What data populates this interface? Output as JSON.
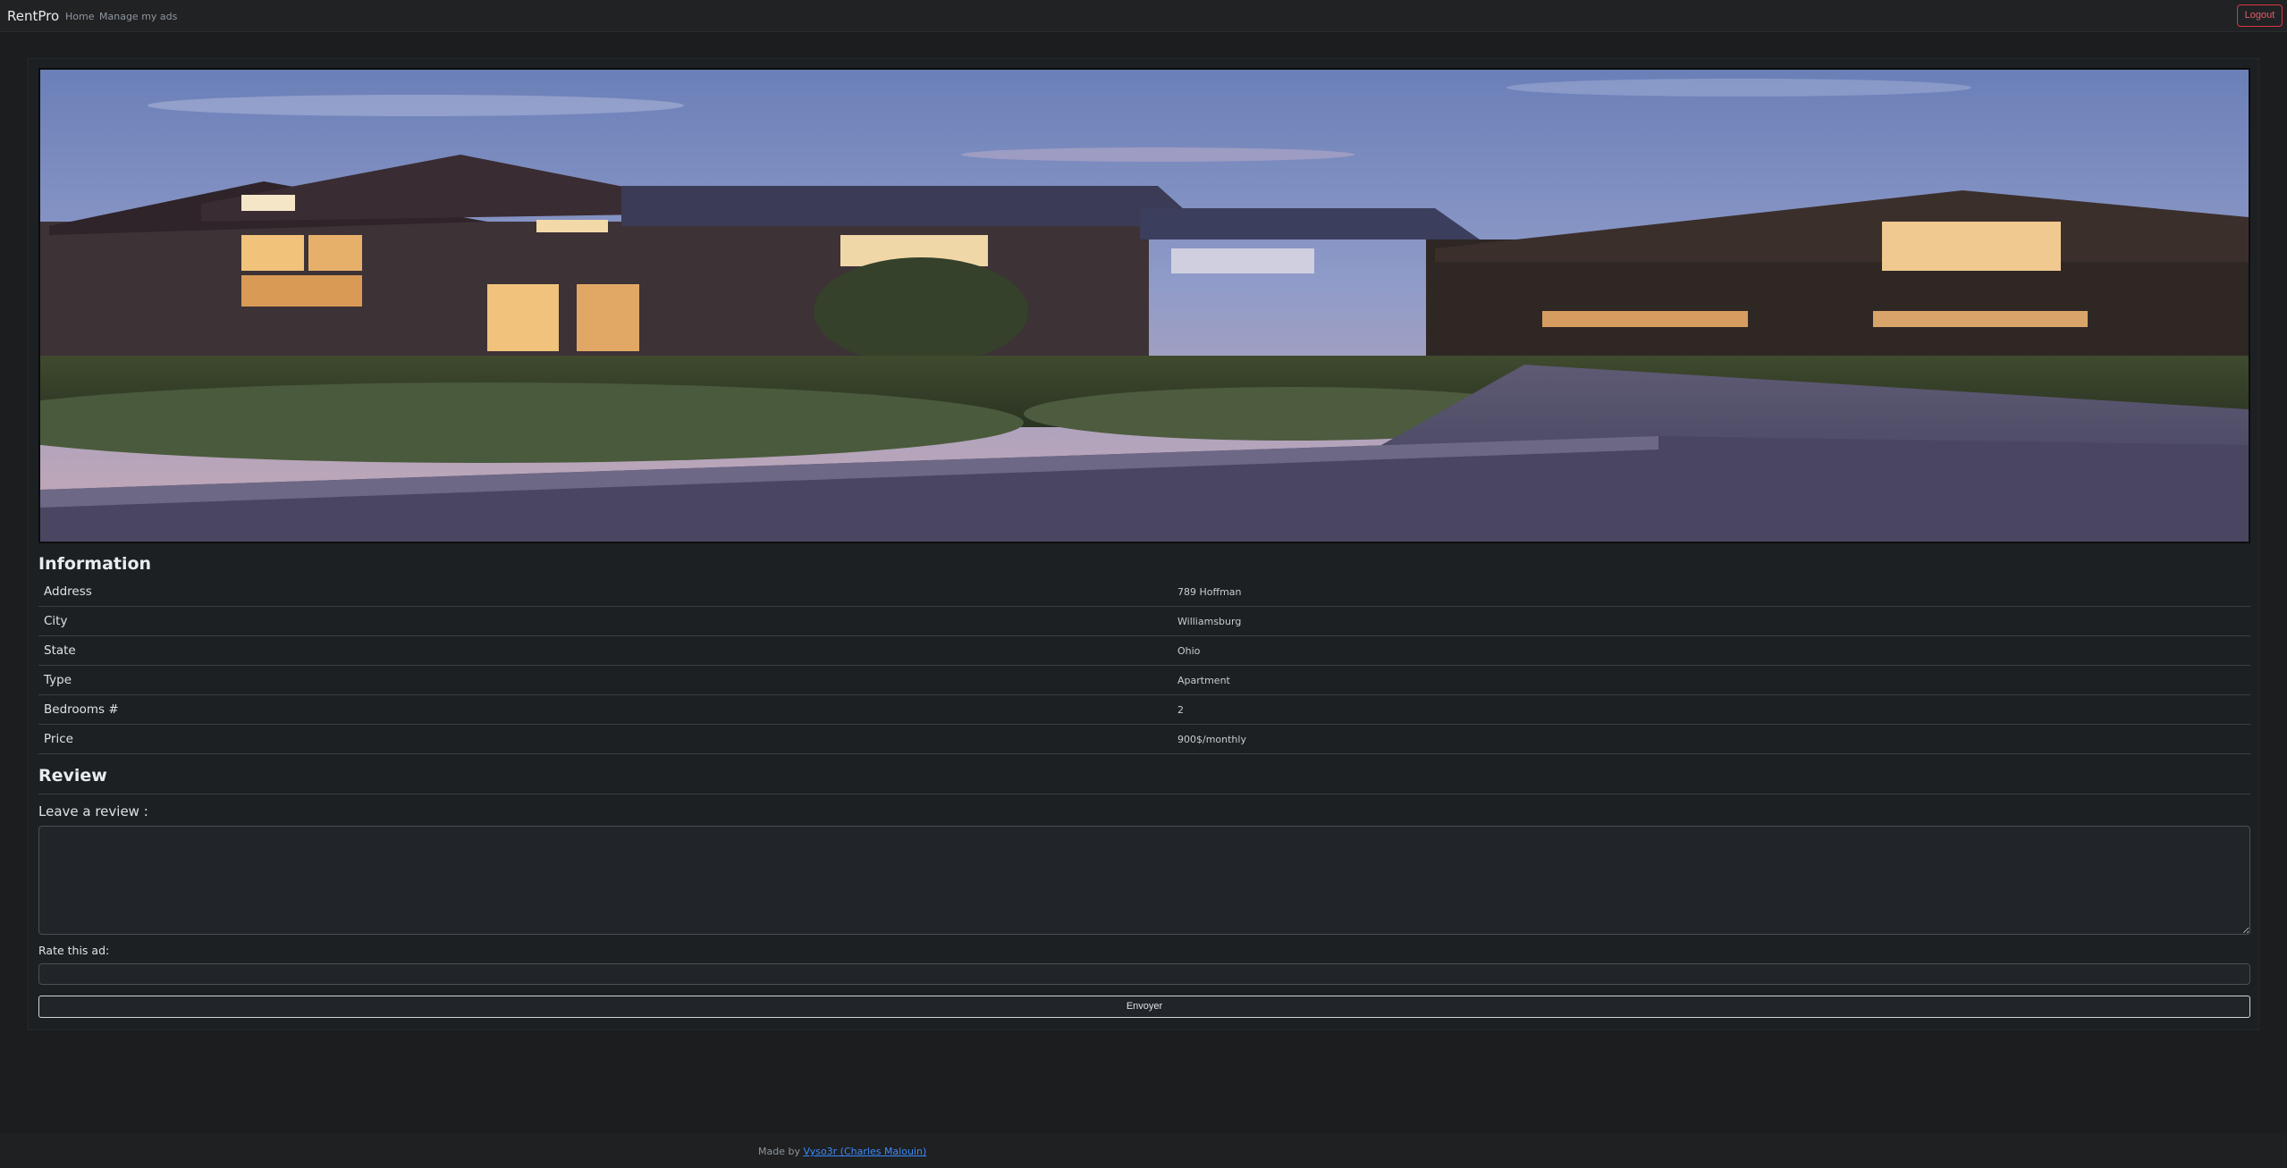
{
  "nav": {
    "brand": "RentPro",
    "home": "Home",
    "manage": "Manage my ads",
    "logout": "Logout"
  },
  "hero": {
    "image": "house-exterior-dusk"
  },
  "information": {
    "title": "Information",
    "rows": [
      {
        "label": "Address",
        "value": "789 Hoffman"
      },
      {
        "label": "City",
        "value": "Williamsburg"
      },
      {
        "label": "State",
        "value": "Ohio"
      },
      {
        "label": "Type",
        "value": "Apartment"
      },
      {
        "label": "Bedrooms #",
        "value": "2"
      },
      {
        "label": "Price",
        "value": "900$/monthly"
      }
    ]
  },
  "review": {
    "title": "Review",
    "leave_label": "Leave a review :",
    "rate_label": "Rate this ad:",
    "submit": "Envoyer"
  },
  "footer": {
    "prefix": "Made by ",
    "author": "Vyso3r (Charles Malouin)"
  }
}
